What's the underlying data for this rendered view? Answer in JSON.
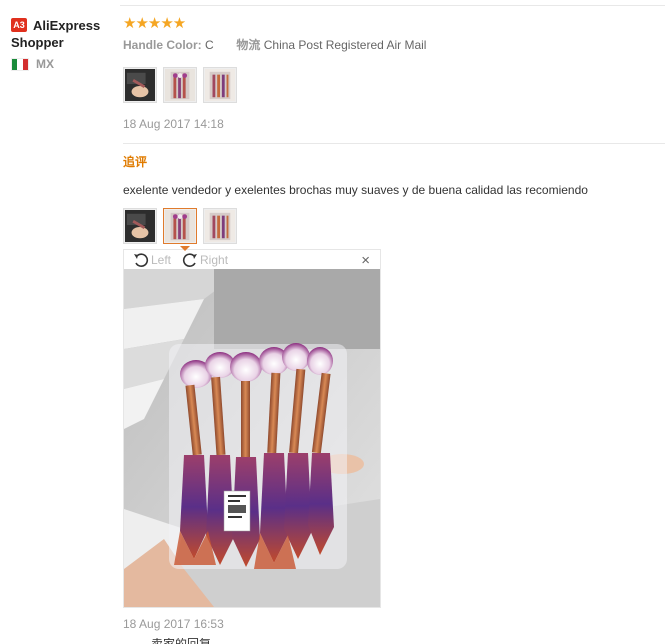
{
  "user": {
    "badge": "A3",
    "name": "AliExpress Shopper",
    "country": "MX",
    "flag_colors": [
      "#1a8b3a",
      "#ffffff",
      "#d32f2f"
    ]
  },
  "review": {
    "stars": "★★★★★",
    "rating": 5,
    "handle_color_label": "Handle Color:",
    "handle_color_value": "C",
    "shipping_label": "物流",
    "shipping_value": "China Post Registered Air Mail",
    "thumbnails": [
      "photo-hand-brushes",
      "photo-brush-pack",
      "photo-brush-pack-2"
    ],
    "date": "18 Aug 2017 14:18"
  },
  "followup": {
    "title": "追评",
    "text": "exelente vendedor y exelentes brochas muy suaves y de buena calidad las recomiendo",
    "thumbnails": [
      "photo-hand-brushes",
      "photo-brush-pack",
      "photo-brush-pack-2"
    ],
    "viewer": {
      "rotate_left_label": "Left",
      "rotate_right_label": "Right",
      "close_label": "×"
    },
    "date": "18 Aug 2017 16:53",
    "next_text": "卖家的回复"
  },
  "colors": {
    "accent_orange": "#e07b00",
    "star": "#f5a623",
    "badge_red": "#e0301e"
  }
}
